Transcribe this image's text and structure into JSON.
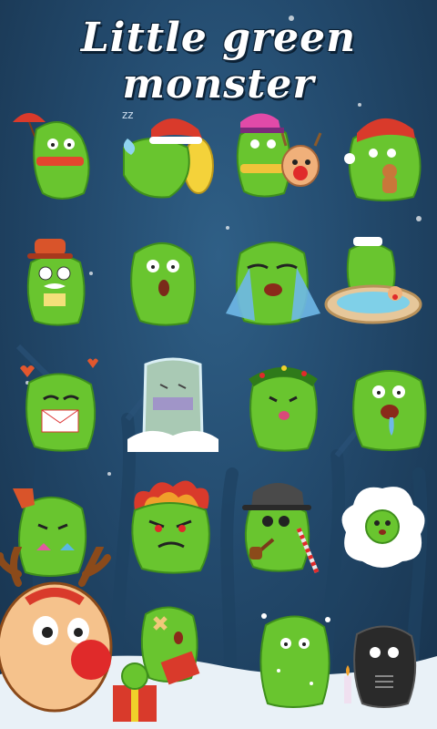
{
  "title": "Little green monster",
  "colors": {
    "monster": "#69c52f",
    "monster_dark": "#3f8f1c",
    "background": "#234a6d"
  },
  "stickers": [
    {
      "id": "umbrella-monster",
      "icon": "umbrella-icon"
    },
    {
      "id": "sleeping-santa-monster",
      "icon": "santa-hat-icon"
    },
    {
      "id": "cap-monster-with-reindeer",
      "icon": "reindeer-icon"
    },
    {
      "id": "santa-gingerbread-monster",
      "icon": "gingerbread-icon"
    },
    {
      "id": "mustache-hat-monster",
      "icon": "hat-icon"
    },
    {
      "id": "surprised-monster",
      "icon": "face-icon"
    },
    {
      "id": "crying-monster",
      "icon": "tears-icon"
    },
    {
      "id": "hot-tub-monster",
      "icon": "hot-tub-icon"
    },
    {
      "id": "love-letter-monster",
      "icon": "heart-icon"
    },
    {
      "id": "frozen-monster",
      "icon": "ice-icon"
    },
    {
      "id": "wreath-monster",
      "icon": "wreath-icon"
    },
    {
      "id": "drooling-monster",
      "icon": "drool-icon"
    },
    {
      "id": "sock-monster",
      "icon": "sock-icon"
    },
    {
      "id": "angry-fire-monster",
      "icon": "fire-icon"
    },
    {
      "id": "gentleman-monster",
      "icon": "pipe-icon"
    },
    {
      "id": "snow-cloud-monster",
      "icon": "cloud-icon"
    },
    {
      "id": "gift-monster",
      "icon": "gift-icon"
    },
    {
      "id": "snowy-monster",
      "icon": "snowflake-icon"
    },
    {
      "id": "birthday-dark-monster",
      "icon": "candle-icon"
    }
  ]
}
